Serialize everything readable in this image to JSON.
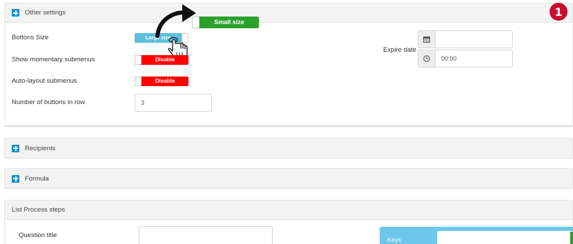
{
  "other_settings": {
    "title": "Other settings",
    "buttons_size": {
      "label": "Bottons Size",
      "toggle_label": "Large size",
      "popup_label": "Small size"
    },
    "momentary_submenus": {
      "label": "Show momentary submenus",
      "toggle_label": "Disable"
    },
    "auto_layout": {
      "label": "Auto-layout submenus",
      "toggle_label": "Disable"
    },
    "buttons_in_row": {
      "label": "Number of buttons in row",
      "value": "3"
    },
    "expire_date": {
      "label": "Expire date",
      "date_value": "",
      "time_value": "00:00",
      "date_icon": "calendar-icon",
      "time_icon": "clock-icon"
    }
  },
  "sections": {
    "recipients": "Recipients",
    "formula": "Formula"
  },
  "list_process_steps": {
    "title": "List Process steps",
    "question_title_label": "Question title",
    "question_title_value": "",
    "keys_label": "Keys"
  },
  "annotation": {
    "step_number": "1"
  },
  "colors": {
    "accent_blue": "#1a8fc7",
    "toggle_light_blue": "#5bc0de",
    "disable_red": "#ff0000",
    "small_size_green": "#2ca02c",
    "badge_red": "#c8102e",
    "keys_panel": "#6ec6ea"
  },
  "icons": {
    "section_toggle": "plus-square-icon",
    "cursor": "hand-pointer-icon",
    "arrow": "curved-arrow-icon"
  }
}
